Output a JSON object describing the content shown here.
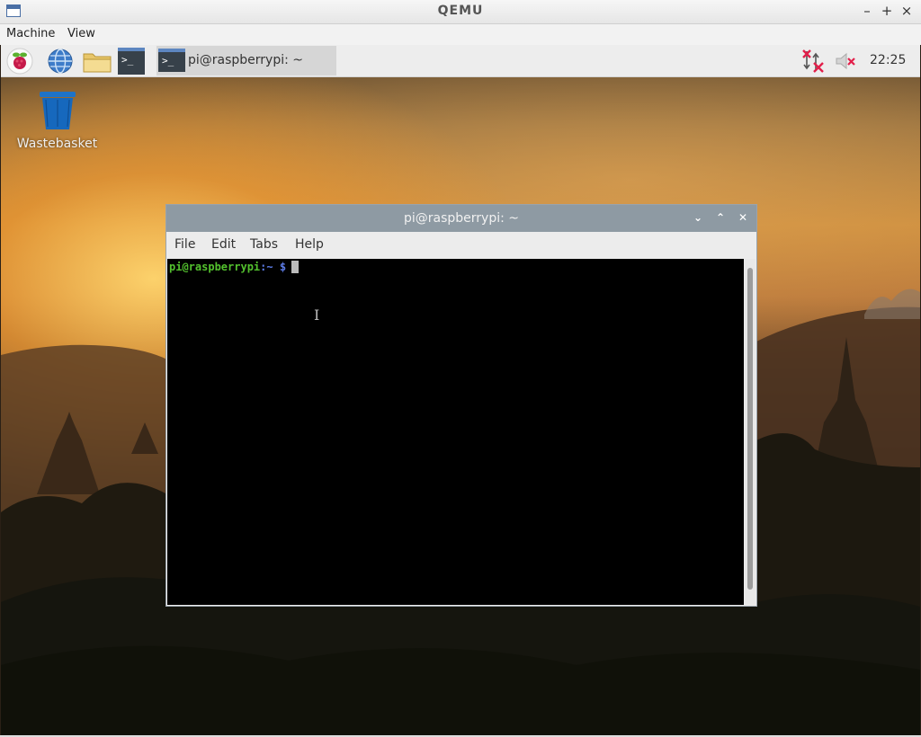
{
  "host_window": {
    "title": "QEMU",
    "controls": {
      "minimize": "–",
      "maximize": "+",
      "close": "×"
    },
    "menu": [
      "Machine",
      "View"
    ]
  },
  "taskbar": {
    "launchers": [
      "raspberry-menu-icon",
      "web-browser-icon",
      "file-manager-icon",
      "terminal-icon"
    ],
    "task": {
      "label": "pi@raspberrypi: ~",
      "icon_text": ">_"
    },
    "tray": [
      "network-disconnected-icon",
      "volume-muted-icon"
    ],
    "clock": "22:25"
  },
  "desktop": {
    "icons": [
      {
        "label": "Wastebasket",
        "icon": "wastebasket-icon"
      }
    ]
  },
  "terminal": {
    "title": "pi@raspberrypi: ~",
    "controls": {
      "minimize": "⌄",
      "maximize": "⌃",
      "close": "✕"
    },
    "menu": [
      "File",
      "Edit",
      "Tabs",
      "Help"
    ],
    "prompt": {
      "user_host": "pi@raspberrypi",
      "sep": ":",
      "path": "~",
      "symbol": "$"
    }
  },
  "colors": {
    "prompt_user": "#53c12e",
    "prompt_path": "#5d7ce8",
    "terminal_bg": "#000000",
    "terminal_titlebar": "#8e9aa3",
    "taskbar_bg": "#ededed"
  }
}
